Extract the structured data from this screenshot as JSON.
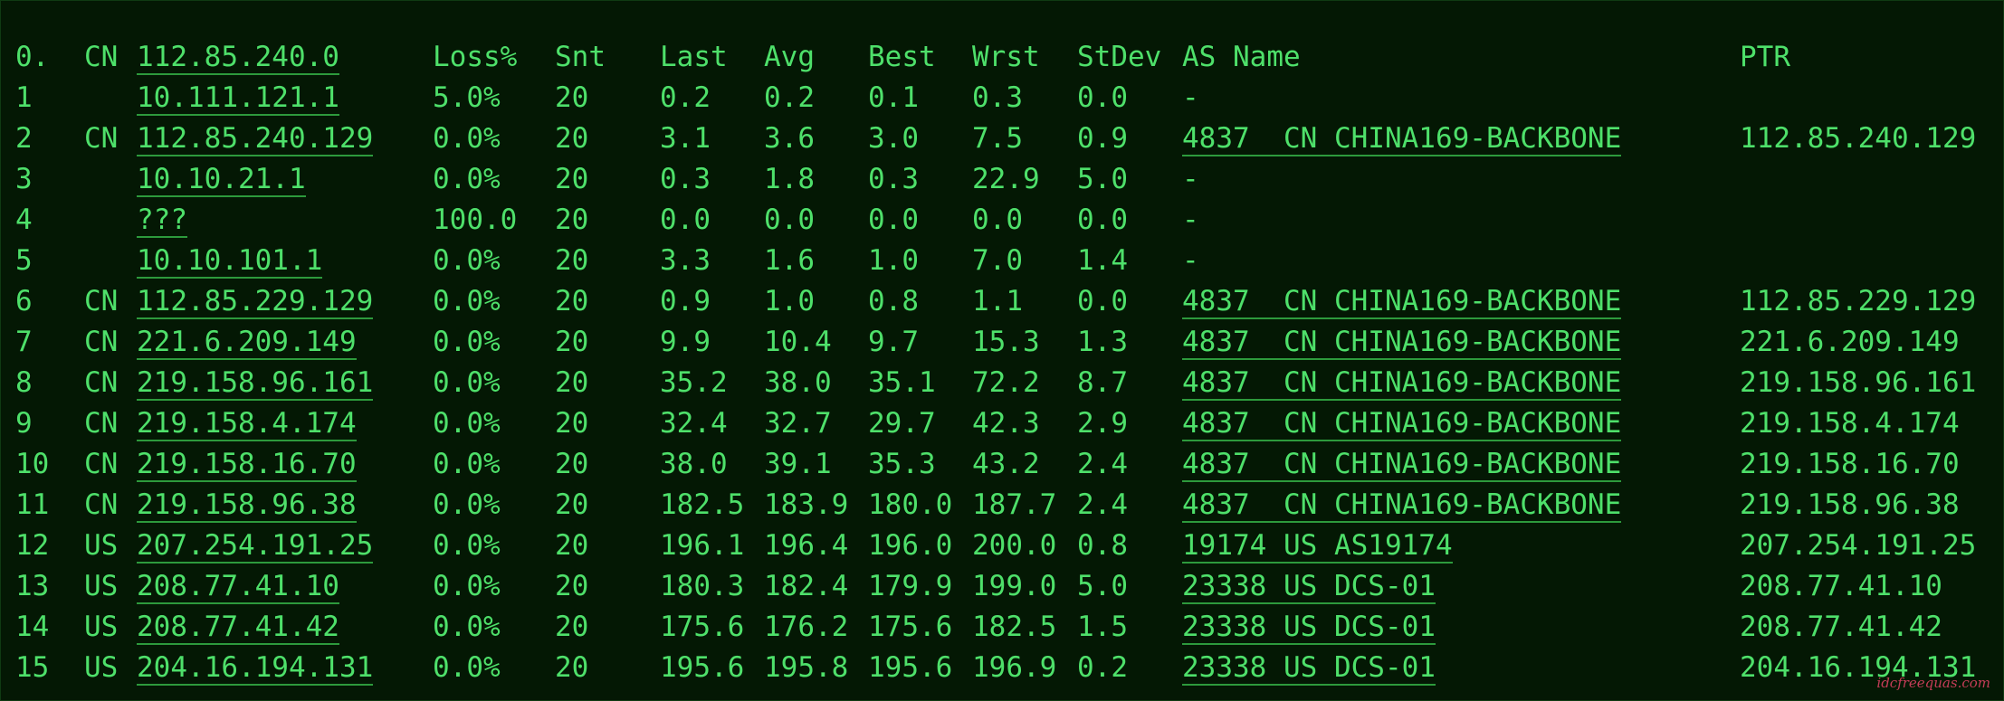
{
  "header": {
    "hop": "0.",
    "cc": "CN",
    "host": "112.85.240.0",
    "loss": "Loss%",
    "snt": "Snt",
    "last": "Last",
    "avg": "Avg",
    "best": "Best",
    "wrst": "Wrst",
    "stdev": "StDev",
    "as": "AS Name",
    "ptr": "PTR"
  },
  "rows": [
    {
      "hop": "1",
      "cc": "",
      "host": "10.111.121.1",
      "loss": "5.0%",
      "snt": "20",
      "last": "0.2",
      "avg": "0.2",
      "best": "0.1",
      "wrst": "0.3",
      "stdev": "0.0",
      "as": "-",
      "ptr": ""
    },
    {
      "hop": "2",
      "cc": "CN",
      "host": "112.85.240.129",
      "loss": "0.0%",
      "snt": "20",
      "last": "3.1",
      "avg": "3.6",
      "best": "3.0",
      "wrst": "7.5",
      "stdev": "0.9",
      "as": "4837  CN CHINA169-BACKBONE",
      "ptr": "112.85.240.129"
    },
    {
      "hop": "3",
      "cc": "",
      "host": "10.10.21.1",
      "loss": "0.0%",
      "snt": "20",
      "last": "0.3",
      "avg": "1.8",
      "best": "0.3",
      "wrst": "22.9",
      "stdev": "5.0",
      "as": "-",
      "ptr": ""
    },
    {
      "hop": "4",
      "cc": "",
      "host": "???",
      "loss": "100.0",
      "snt": "20",
      "last": "0.0",
      "avg": "0.0",
      "best": "0.0",
      "wrst": "0.0",
      "stdev": "0.0",
      "as": "-",
      "ptr": ""
    },
    {
      "hop": "5",
      "cc": "",
      "host": "10.10.101.1",
      "loss": "0.0%",
      "snt": "20",
      "last": "3.3",
      "avg": "1.6",
      "best": "1.0",
      "wrst": "7.0",
      "stdev": "1.4",
      "as": "-",
      "ptr": ""
    },
    {
      "hop": "6",
      "cc": "CN",
      "host": "112.85.229.129",
      "loss": "0.0%",
      "snt": "20",
      "last": "0.9",
      "avg": "1.0",
      "best": "0.8",
      "wrst": "1.1",
      "stdev": "0.0",
      "as": "4837  CN CHINA169-BACKBONE",
      "ptr": "112.85.229.129"
    },
    {
      "hop": "7",
      "cc": "CN",
      "host": "221.6.209.149",
      "loss": "0.0%",
      "snt": "20",
      "last": "9.9",
      "avg": "10.4",
      "best": "9.7",
      "wrst": "15.3",
      "stdev": "1.3",
      "as": "4837  CN CHINA169-BACKBONE",
      "ptr": "221.6.209.149"
    },
    {
      "hop": "8",
      "cc": "CN",
      "host": "219.158.96.161",
      "loss": "0.0%",
      "snt": "20",
      "last": "35.2",
      "avg": "38.0",
      "best": "35.1",
      "wrst": "72.2",
      "stdev": "8.7",
      "as": "4837  CN CHINA169-BACKBONE",
      "ptr": "219.158.96.161"
    },
    {
      "hop": "9",
      "cc": "CN",
      "host": "219.158.4.174",
      "loss": "0.0%",
      "snt": "20",
      "last": "32.4",
      "avg": "32.7",
      "best": "29.7",
      "wrst": "42.3",
      "stdev": "2.9",
      "as": "4837  CN CHINA169-BACKBONE",
      "ptr": "219.158.4.174"
    },
    {
      "hop": "10",
      "cc": "CN",
      "host": "219.158.16.70",
      "loss": "0.0%",
      "snt": "20",
      "last": "38.0",
      "avg": "39.1",
      "best": "35.3",
      "wrst": "43.2",
      "stdev": "2.4",
      "as": "4837  CN CHINA169-BACKBONE",
      "ptr": "219.158.16.70"
    },
    {
      "hop": "11",
      "cc": "CN",
      "host": "219.158.96.38",
      "loss": "0.0%",
      "snt": "20",
      "last": "182.5",
      "avg": "183.9",
      "best": "180.0",
      "wrst": "187.7",
      "stdev": "2.4",
      "as": "4837  CN CHINA169-BACKBONE",
      "ptr": "219.158.96.38"
    },
    {
      "hop": "12",
      "cc": "US",
      "host": "207.254.191.25",
      "loss": "0.0%",
      "snt": "20",
      "last": "196.1",
      "avg": "196.4",
      "best": "196.0",
      "wrst": "200.0",
      "stdev": "0.8",
      "as": "19174 US AS19174",
      "ptr": "207.254.191.25"
    },
    {
      "hop": "13",
      "cc": "US",
      "host": "208.77.41.10",
      "loss": "0.0%",
      "snt": "20",
      "last": "180.3",
      "avg": "182.4",
      "best": "179.9",
      "wrst": "199.0",
      "stdev": "5.0",
      "as": "23338 US DCS-01",
      "ptr": "208.77.41.10"
    },
    {
      "hop": "14",
      "cc": "US",
      "host": "208.77.41.42",
      "loss": "0.0%",
      "snt": "20",
      "last": "175.6",
      "avg": "176.2",
      "best": "175.6",
      "wrst": "182.5",
      "stdev": "1.5",
      "as": "23338 US DCS-01",
      "ptr": "208.77.41.42"
    },
    {
      "hop": "15",
      "cc": "US",
      "host": "204.16.194.131",
      "loss": "0.0%",
      "snt": "20",
      "last": "195.6",
      "avg": "195.8",
      "best": "195.6",
      "wrst": "196.9",
      "stdev": "0.2",
      "as": "23338 US DCS-01",
      "ptr": "204.16.194.131"
    }
  ],
  "watermark": "idcfreequas.com",
  "colors": {
    "background": "#041804",
    "text": "#4ee06a",
    "underline": "#2d9a3c",
    "watermark": "#d94060"
  }
}
